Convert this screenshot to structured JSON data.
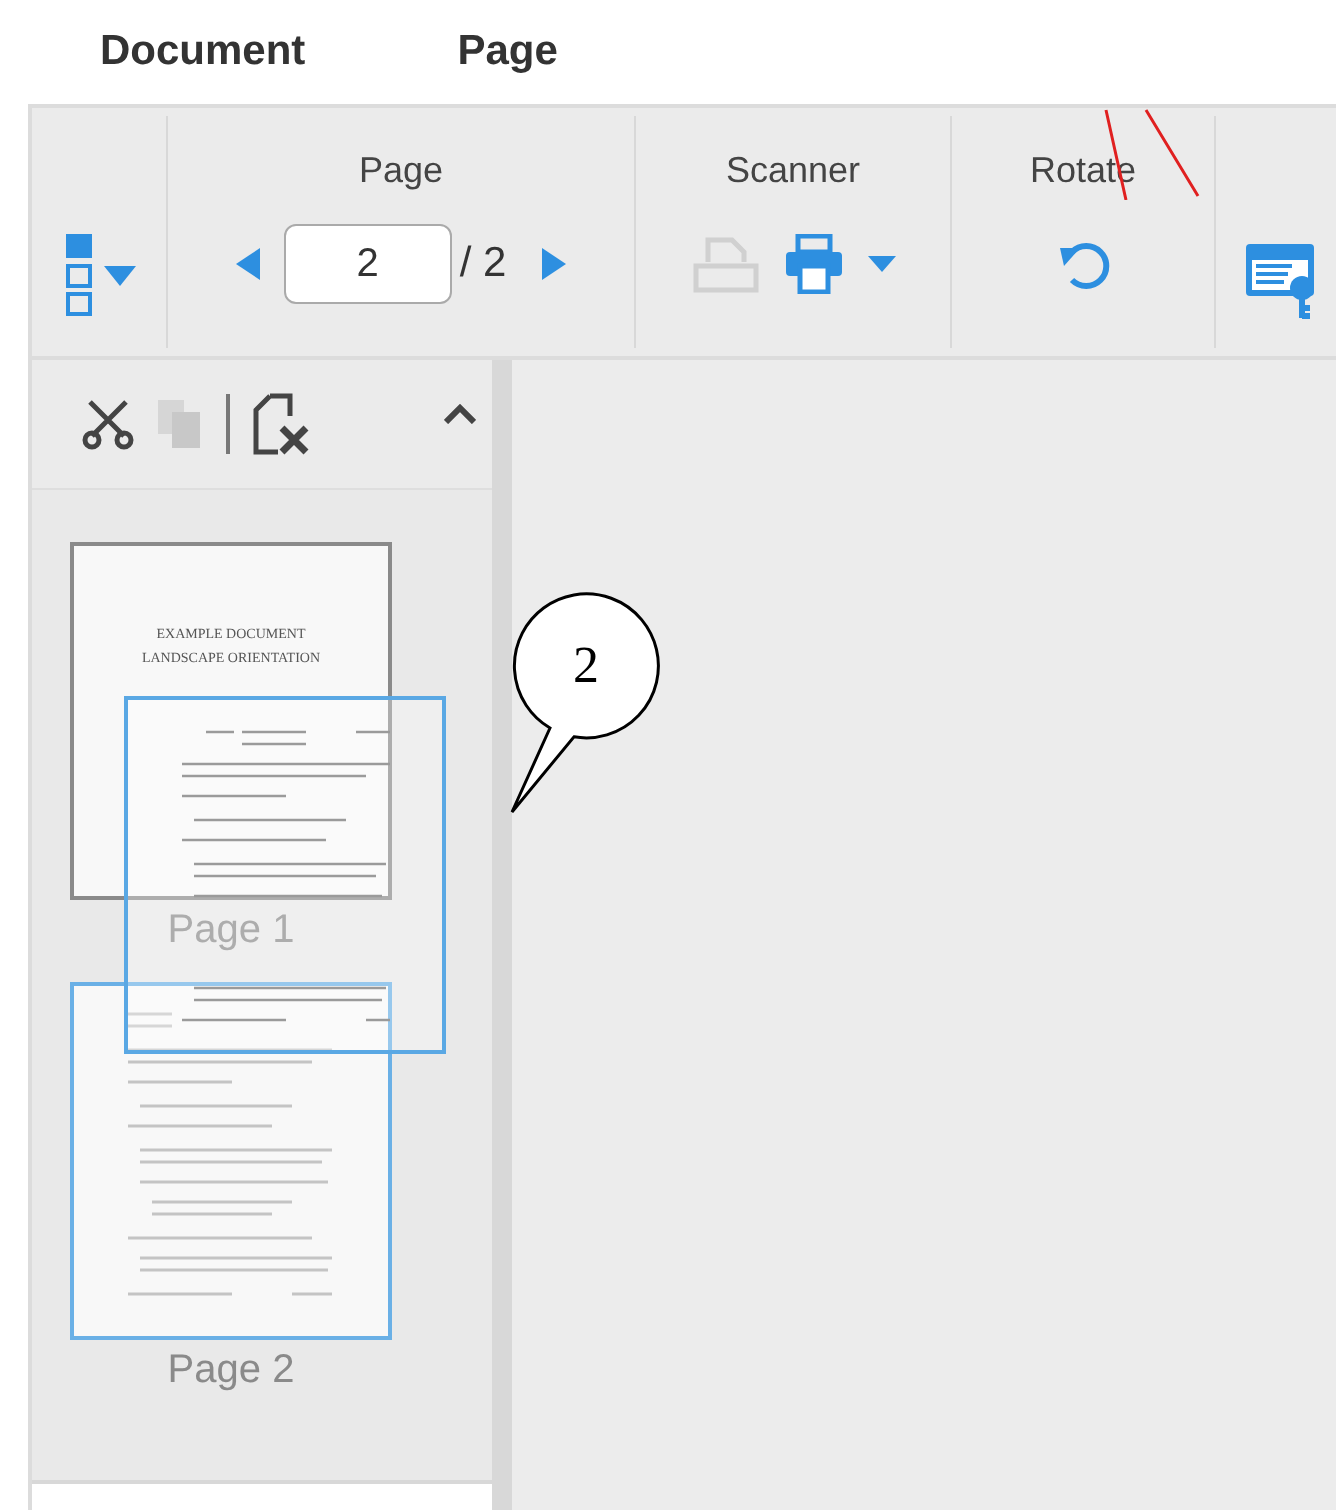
{
  "menu": [
    {
      "label": "Document"
    },
    {
      "label": "Page"
    }
  ],
  "toolbar": {
    "groups": [
      {
        "kind": "view"
      },
      {
        "kind": "page",
        "label": "Page",
        "page_value": "2",
        "page_total": "/ 2"
      },
      {
        "kind": "scanner",
        "label": "Scanner",
        "scan_disabled": true
      },
      {
        "kind": "rotate",
        "label": "Rotate"
      },
      {
        "kind": "edit"
      }
    ]
  },
  "panel_tools": {
    "copy_disabled": true
  },
  "thumbnails": [
    {
      "label": "Page 1",
      "selected": false,
      "title_lines": [
        "EXAMPLE DOCUMENT",
        "LANDSCAPE ORIENTATION"
      ]
    },
    {
      "label": "Page 2",
      "selected": true
    }
  ],
  "drag_preview": {
    "visible": true
  },
  "annotations": {
    "callout": "2",
    "strokes": true
  }
}
